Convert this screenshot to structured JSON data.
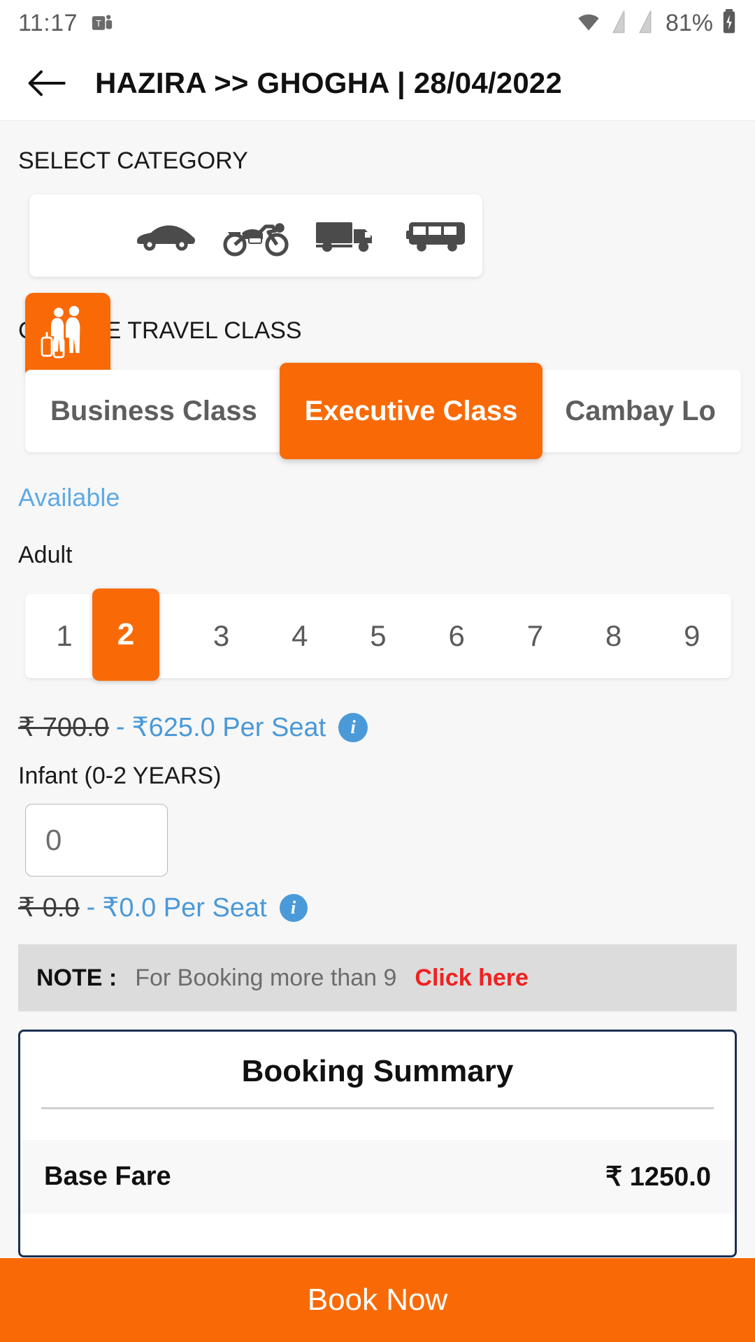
{
  "statusbar": {
    "time": "11:17",
    "teams_icon": "microsoft-teams-icon",
    "wifi_icon": "wifi-icon",
    "sim1_icon": "sim-signal-icon",
    "sim2_icon": "sim-signal-icon",
    "battery_text": "81%",
    "battery_icon": "battery-charging-icon"
  },
  "appbar": {
    "back_icon": "back-arrow-icon",
    "title": "HAZIRA >> GHOGHA | 28/04/2022"
  },
  "category": {
    "label": "SELECT CATEGORY",
    "selected_index": 0,
    "items": [
      {
        "icon": "passengers-icon",
        "name": "passenger"
      },
      {
        "icon": "car-icon",
        "name": "car"
      },
      {
        "icon": "motorcycle-icon",
        "name": "motorcycle"
      },
      {
        "icon": "truck-icon",
        "name": "truck"
      },
      {
        "icon": "bus-icon",
        "name": "bus"
      }
    ]
  },
  "travel_class": {
    "label": "CHOOSE TRAVEL CLASS",
    "selected_index": 1,
    "tabs": [
      {
        "label": "Business Class"
      },
      {
        "label": "Executive Class"
      },
      {
        "label": "Cambay Lo"
      }
    ],
    "availability": "Available"
  },
  "adult": {
    "label": "Adult",
    "options": [
      "1",
      "2",
      "3",
      "4",
      "5",
      "6",
      "7",
      "8",
      "9"
    ],
    "selected": "2",
    "price_old": "₹ 700.0",
    "price_sep": "-",
    "price_new": "₹625.0 Per Seat",
    "info_icon": "info-icon"
  },
  "infant": {
    "label": "Infant (0-2 YEARS)",
    "value": "0",
    "placeholder": "0",
    "price_old": "₹ 0.0",
    "price_sep": "-",
    "price_new": "₹0.0 Per Seat",
    "info_icon": "info-icon"
  },
  "note": {
    "key": "NOTE :",
    "text": "For Booking more than 9",
    "link": "Click here"
  },
  "summary": {
    "title": "Booking Summary",
    "rows": [
      {
        "label": "Base Fare",
        "value": "₹ 1250.0"
      }
    ]
  },
  "footer": {
    "book_now": "Book Now"
  },
  "colors": {
    "accent_orange": "#f96a06",
    "link_blue": "#4a99d8",
    "note_red": "#ef2222",
    "summary_border": "#1b3050",
    "page_bg": "#f7f7f7"
  }
}
